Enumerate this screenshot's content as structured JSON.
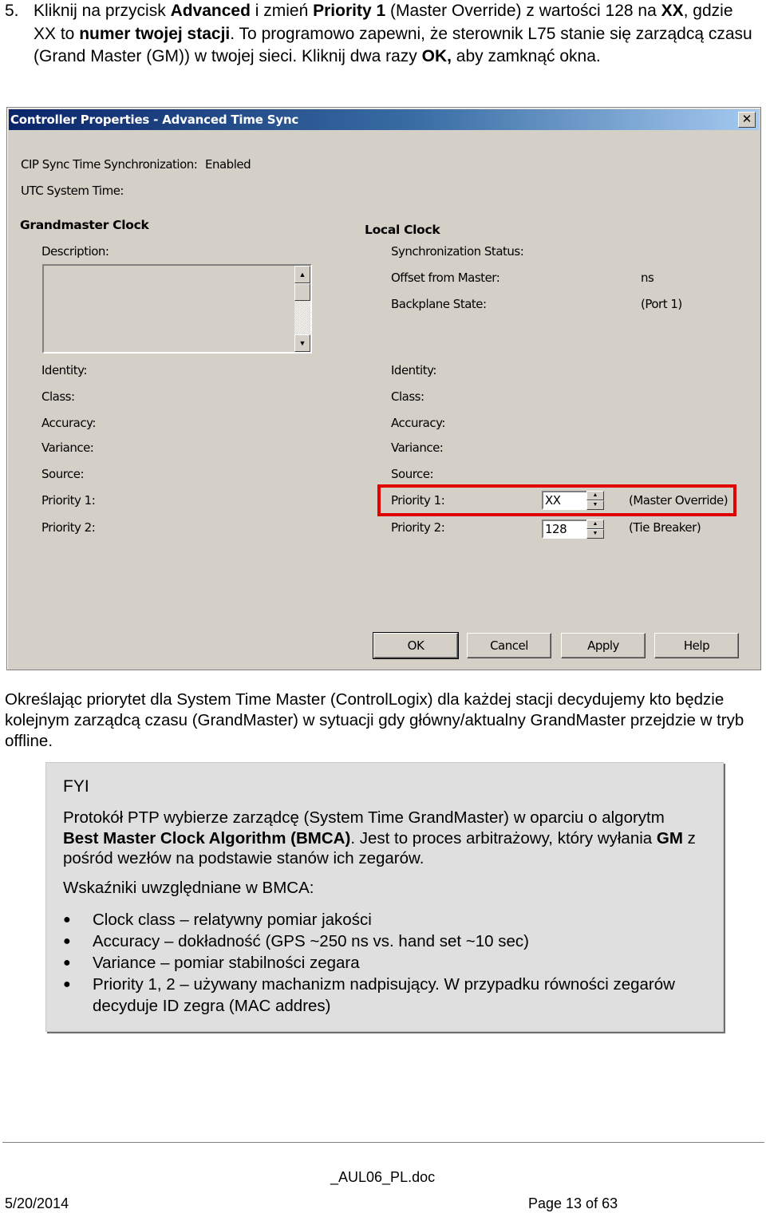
{
  "step": {
    "number": "5.",
    "segments": [
      {
        "text": "Kliknij na przycisk ",
        "bold": false
      },
      {
        "text": "Advanced",
        "bold": true
      },
      {
        "text": " i zmień ",
        "bold": false
      },
      {
        "text": "Priority 1",
        "bold": true
      },
      {
        "text": " (Master Override) z wartości 128 na ",
        "bold": false
      },
      {
        "text": "XX",
        "bold": true
      },
      {
        "text": ", gdzie XX to ",
        "bold": false
      },
      {
        "text": "numer twojej stacji",
        "bold": true
      },
      {
        "text": ". To programowo zapewni, że sterownik L75 stanie się zarządcą czasu (Grand Master (GM)) w twojej sieci. Kliknij dwa razy ",
        "bold": false
      },
      {
        "text": "OK,",
        "bold": true
      },
      {
        "text": " aby zamknąć okna.",
        "bold": false
      }
    ]
  },
  "dialog": {
    "title": "Controller Properties - Advanced Time Sync",
    "close_label": "✕",
    "cip_sync_label": "CIP Sync Time Synchronization:",
    "cip_sync_value": "Enabled",
    "utc_label": "UTC System Time:",
    "grandmaster": {
      "heading": "Grandmaster Clock",
      "description_label": "Description:",
      "description_value": "",
      "fields": [
        "Identity:",
        "Class:",
        "Accuracy:",
        "Variance:",
        "Source:",
        "Priority 1:",
        "Priority 2:"
      ]
    },
    "local": {
      "heading": "Local Clock",
      "sync_status_label": "Synchronization Status:",
      "offset_label": "Offset from Master:",
      "offset_unit": "ns",
      "backplane_label": "Backplane State:",
      "backplane_value": "(Port 1)",
      "fields": [
        "Identity:",
        "Class:",
        "Accuracy:",
        "Variance:",
        "Source:"
      ],
      "priority1_label": "Priority 1:",
      "priority1_value": "XX",
      "priority1_note": "(Master Override)",
      "priority2_label": "Priority 2:",
      "priority2_value": "128",
      "priority2_note": "(Tie Breaker)"
    },
    "buttons": {
      "ok": "OK",
      "cancel": "Cancel",
      "apply": "Apply",
      "help": "Help"
    },
    "highlight_color": "#e00000"
  },
  "paragraph": "Określając priorytet dla System Time Master (ControlLogix) dla każdej stacji decydujemy kto będzie kolejnym zarządcą czasu (GrandMaster) w sytuacji gdy główny/aktualny GrandMaster przejdzie w tryb offline.",
  "fyi": {
    "title": "FYI",
    "segments": [
      {
        "text": "Protokół PTP wybierze zarządcę (System Time GrandMaster) w oparciu o algorytm ",
        "bold": false
      },
      {
        "text": "Best Master Clock Algorithm (BMCA)",
        "bold": true
      },
      {
        "text": ". Jest to proces arbitrażowy, który wyłania ",
        "bold": false
      },
      {
        "text": "GM",
        "bold": true
      },
      {
        "text": " z pośród wezłów na podstawie stanów ich zegarów.",
        "bold": false
      }
    ],
    "indicators_label": "Wskaźniki uwzględniane w  BMCA:",
    "bullets": [
      "Clock class – relatywny pomiar jakości",
      "Accuracy – dokładność (GPS ~250 ns vs. hand set ~10 sec)",
      "Variance – pomiar stabilności zegara",
      "Priority 1, 2 – używany machanizm nadpisujący. W przypadku równości zegarów decyduje ID zegra (MAC addres)"
    ]
  },
  "footer": {
    "doc_name": "_AUL06_PL.doc",
    "date": "5/20/2014",
    "page": "Page 13 of 63"
  }
}
